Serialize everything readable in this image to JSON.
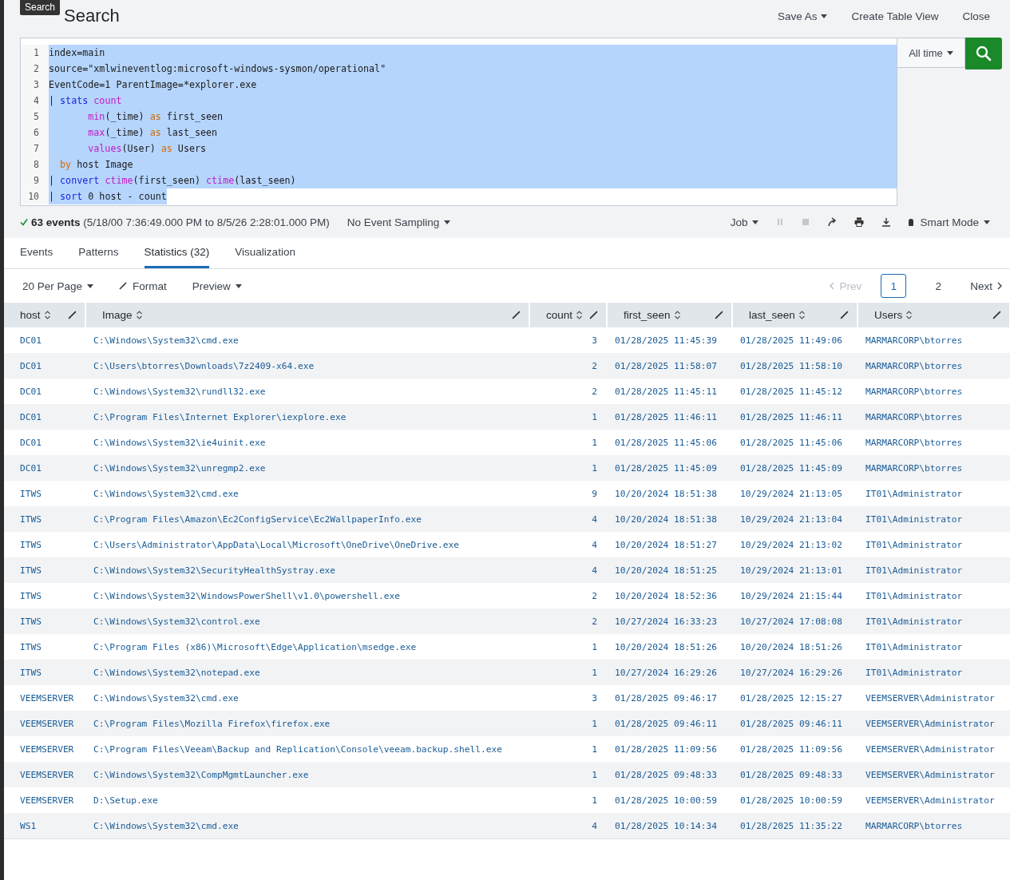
{
  "tooltip": "Search",
  "title": "Search",
  "header_actions": [
    {
      "label": "Save As",
      "dropdown": true
    },
    {
      "label": "Create Table View",
      "dropdown": false
    },
    {
      "label": "Close",
      "dropdown": false
    }
  ],
  "editor": {
    "lines": [
      {
        "number": "1",
        "selected": true,
        "tokens": [
          {
            "kind": "plain",
            "text": "index=main"
          }
        ]
      },
      {
        "number": "2",
        "selected": true,
        "tokens": [
          {
            "kind": "plain",
            "text": "source=\"xmlwineventlog:microsoft-windows-sysmon/operational\""
          }
        ]
      },
      {
        "number": "3",
        "selected": true,
        "tokens": [
          {
            "kind": "plain",
            "text": "EventCode=1 ParentImage=*explorer.exe"
          }
        ]
      },
      {
        "number": "4",
        "selected": true,
        "tokens": [
          {
            "kind": "plain",
            "text": "| "
          },
          {
            "kind": "command",
            "text": "stats "
          },
          {
            "kind": "function",
            "text": "count"
          }
        ]
      },
      {
        "number": "5",
        "selected": true,
        "tokens": [
          {
            "kind": "function",
            "text": "       min"
          },
          {
            "kind": "plain",
            "text": "(_time) "
          },
          {
            "kind": "keyword",
            "text": "as"
          },
          {
            "kind": "plain",
            "text": " first_seen"
          }
        ]
      },
      {
        "number": "6",
        "selected": true,
        "tokens": [
          {
            "kind": "function",
            "text": "       max"
          },
          {
            "kind": "plain",
            "text": "(_time) "
          },
          {
            "kind": "keyword",
            "text": "as"
          },
          {
            "kind": "plain",
            "text": " last_seen"
          }
        ]
      },
      {
        "number": "7",
        "selected": true,
        "tokens": [
          {
            "kind": "function",
            "text": "       values"
          },
          {
            "kind": "plain",
            "text": "(User) "
          },
          {
            "kind": "keyword",
            "text": "as"
          },
          {
            "kind": "plain",
            "text": " Users"
          }
        ]
      },
      {
        "number": "8",
        "selected": true,
        "tokens": [
          {
            "kind": "keyword",
            "text": "  by"
          },
          {
            "kind": "plain",
            "text": " host Image"
          }
        ]
      },
      {
        "number": "9",
        "selected": true,
        "tokens": [
          {
            "kind": "plain",
            "text": "| "
          },
          {
            "kind": "command",
            "text": "convert "
          },
          {
            "kind": "function",
            "text": "ctime"
          },
          {
            "kind": "plain",
            "text": "(first_seen) "
          },
          {
            "kind": "function",
            "text": "ctime"
          },
          {
            "kind": "plain",
            "text": "(last_seen)"
          }
        ]
      },
      {
        "number": "10",
        "selected": true,
        "tokens": [
          {
            "kind": "plain",
            "text": "| "
          },
          {
            "kind": "command",
            "text": "sort"
          },
          {
            "kind": "plain",
            "text": " 0 host - count"
          }
        ]
      }
    ]
  },
  "time_picker": "All time",
  "status": {
    "count": "63 events",
    "range": "(5/18/00 7:36:49.000 PM to 8/5/26 2:28:01.000 PM)",
    "sampling": "No Event Sampling",
    "job": "Job",
    "mode": "Smart Mode"
  },
  "tabs": [
    {
      "label": "Events",
      "selected": false
    },
    {
      "label": "Patterns",
      "selected": false
    },
    {
      "label": "Statistics (32)",
      "selected": true
    },
    {
      "label": "Visualization",
      "selected": false
    }
  ],
  "toolbar": {
    "per_page": "20 Per Page",
    "format": "Format",
    "preview": "Preview"
  },
  "pagination": {
    "prev": "Prev",
    "pages": [
      {
        "label": "1",
        "selected": true
      },
      {
        "label": "2",
        "selected": false
      }
    ],
    "next": "Next"
  },
  "table": {
    "columns": [
      {
        "label": "host"
      },
      {
        "label": "Image"
      },
      {
        "label": "count"
      },
      {
        "label": "first_seen"
      },
      {
        "label": "last_seen"
      },
      {
        "label": "Users"
      }
    ],
    "rows": [
      [
        "DC01",
        "C:\\Windows\\System32\\cmd.exe",
        "3",
        "01/28/2025 11:45:39",
        "01/28/2025 11:49:06",
        "MARMARCORP\\btorres"
      ],
      [
        "DC01",
        "C:\\Users\\btorres\\Downloads\\7z2409-x64.exe",
        "2",
        "01/28/2025 11:58:07",
        "01/28/2025 11:58:10",
        "MARMARCORP\\btorres"
      ],
      [
        "DC01",
        "C:\\Windows\\System32\\rundll32.exe",
        "2",
        "01/28/2025 11:45:11",
        "01/28/2025 11:45:12",
        "MARMARCORP\\btorres"
      ],
      [
        "DC01",
        "C:\\Program Files\\Internet Explorer\\iexplore.exe",
        "1",
        "01/28/2025 11:46:11",
        "01/28/2025 11:46:11",
        "MARMARCORP\\btorres"
      ],
      [
        "DC01",
        "C:\\Windows\\System32\\ie4uinit.exe",
        "1",
        "01/28/2025 11:45:06",
        "01/28/2025 11:45:06",
        "MARMARCORP\\btorres"
      ],
      [
        "DC01",
        "C:\\Windows\\System32\\unregmp2.exe",
        "1",
        "01/28/2025 11:45:09",
        "01/28/2025 11:45:09",
        "MARMARCORP\\btorres"
      ],
      [
        "ITWS",
        "C:\\Windows\\System32\\cmd.exe",
        "9",
        "10/20/2024 18:51:38",
        "10/29/2024 21:13:05",
        "IT01\\Administrator"
      ],
      [
        "ITWS",
        "C:\\Program Files\\Amazon\\Ec2ConfigService\\Ec2WallpaperInfo.exe",
        "4",
        "10/20/2024 18:51:38",
        "10/29/2024 21:13:04",
        "IT01\\Administrator"
      ],
      [
        "ITWS",
        "C:\\Users\\Administrator\\AppData\\Local\\Microsoft\\OneDrive\\OneDrive.exe",
        "4",
        "10/20/2024 18:51:27",
        "10/29/2024 21:13:02",
        "IT01\\Administrator"
      ],
      [
        "ITWS",
        "C:\\Windows\\System32\\SecurityHealthSystray.exe",
        "4",
        "10/20/2024 18:51:25",
        "10/29/2024 21:13:01",
        "IT01\\Administrator"
      ],
      [
        "ITWS",
        "C:\\Windows\\System32\\WindowsPowerShell\\v1.0\\powershell.exe",
        "2",
        "10/20/2024 18:52:36",
        "10/29/2024 21:15:44",
        "IT01\\Administrator"
      ],
      [
        "ITWS",
        "C:\\Windows\\System32\\control.exe",
        "2",
        "10/27/2024 16:33:23",
        "10/27/2024 17:08:08",
        "IT01\\Administrator"
      ],
      [
        "ITWS",
        "C:\\Program Files (x86)\\Microsoft\\Edge\\Application\\msedge.exe",
        "1",
        "10/20/2024 18:51:26",
        "10/20/2024 18:51:26",
        "IT01\\Administrator"
      ],
      [
        "ITWS",
        "C:\\Windows\\System32\\notepad.exe",
        "1",
        "10/27/2024 16:29:26",
        "10/27/2024 16:29:26",
        "IT01\\Administrator"
      ],
      [
        "VEEMSERVER",
        "C:\\Windows\\System32\\cmd.exe",
        "3",
        "01/28/2025 09:46:17",
        "01/28/2025 12:15:27",
        "VEEMSERVER\\Administrator"
      ],
      [
        "VEEMSERVER",
        "C:\\Program Files\\Mozilla Firefox\\firefox.exe",
        "1",
        "01/28/2025 09:46:11",
        "01/28/2025 09:46:11",
        "VEEMSERVER\\Administrator"
      ],
      [
        "VEEMSERVER",
        "C:\\Program Files\\Veeam\\Backup and Replication\\Console\\veeam.backup.shell.exe",
        "1",
        "01/28/2025 11:09:56",
        "01/28/2025 11:09:56",
        "VEEMSERVER\\Administrator"
      ],
      [
        "VEEMSERVER",
        "C:\\Windows\\System32\\CompMgmtLauncher.exe",
        "1",
        "01/28/2025 09:48:33",
        "01/28/2025 09:48:33",
        "VEEMSERVER\\Administrator"
      ],
      [
        "VEEMSERVER",
        "D:\\Setup.exe",
        "1",
        "01/28/2025 10:00:59",
        "01/28/2025 10:00:59",
        "VEEMSERVER\\Administrator"
      ],
      [
        "WS1",
        "C:\\Windows\\System32\\cmd.exe",
        "4",
        "01/28/2025 10:14:34",
        "01/28/2025 11:35:22",
        "MARMARCORP\\btorres"
      ]
    ]
  }
}
